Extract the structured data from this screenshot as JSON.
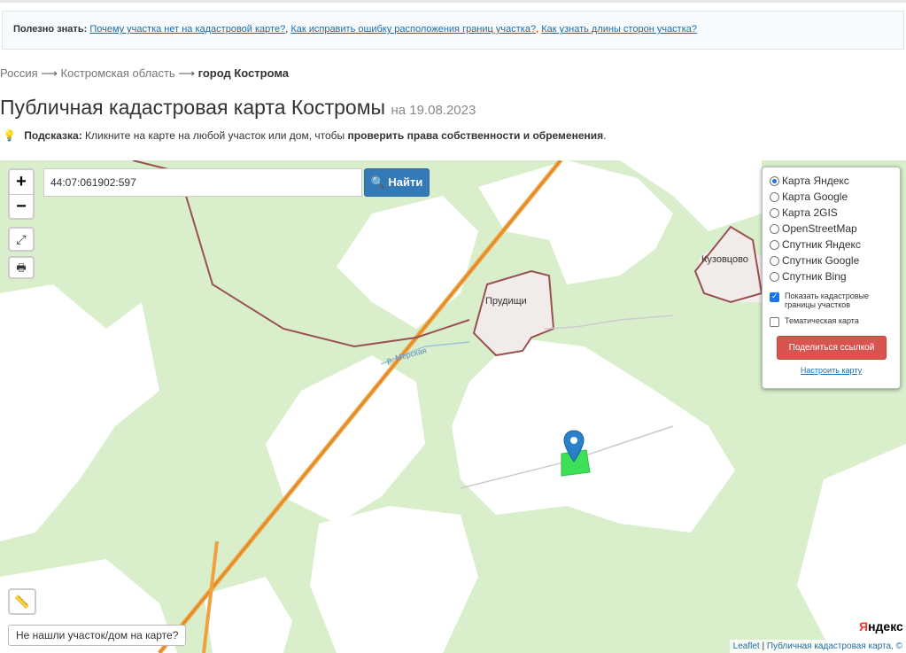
{
  "info": {
    "label": "Полезно знать:",
    "links": [
      "Почему участка нет на кадастровой карте?",
      "Как исправить ошибку расположения границ участка?",
      "Как узнать длины сторон участка?"
    ]
  },
  "breadcrumb": {
    "items": [
      "Россия",
      "Костромская область"
    ],
    "current": "город Кострома",
    "separator": "⟶"
  },
  "page": {
    "title": "Публичная кадастровая карта Костромы",
    "date": "на 19.08.2023"
  },
  "hint": {
    "label": "Подсказка:",
    "text": "Кликните на карте на любой участок или дом, чтобы",
    "bold": "проверить права собственности и обременения",
    "end": "."
  },
  "map": {
    "zoom_in": "+",
    "zoom_out": "−",
    "search_value": "44:07:061902:597",
    "find_label": "Найти",
    "labels": {
      "prudishchi": "Прудищи",
      "kuzovtsovo": "Кузовцово",
      "river": "р. Мерская"
    },
    "not_found": "Не нашли участок/дом на карте?",
    "yandex_logo": {
      "first": "Я",
      "rest": "ндекс"
    },
    "attribution": {
      "leaflet": "Leaflet",
      "sep": " | ",
      "source": "Публичная кадастровая карта, ©"
    }
  },
  "layers": {
    "options": [
      {
        "label": "Карта Яндекс",
        "selected": true
      },
      {
        "label": "Карта Google",
        "selected": false
      },
      {
        "label": "Карта 2GIS",
        "selected": false
      },
      {
        "label": "OpenStreetMap",
        "selected": false
      },
      {
        "label": "Спутник Яндекс",
        "selected": false
      },
      {
        "label": "Спутник Google",
        "selected": false
      },
      {
        "label": "Спутник Bing",
        "selected": false
      }
    ],
    "show_borders": "Показать кадастровые границы участков",
    "thematic": "Тематическая карта",
    "share": "Поделиться ссылкой",
    "setup": "Настроить карту"
  }
}
